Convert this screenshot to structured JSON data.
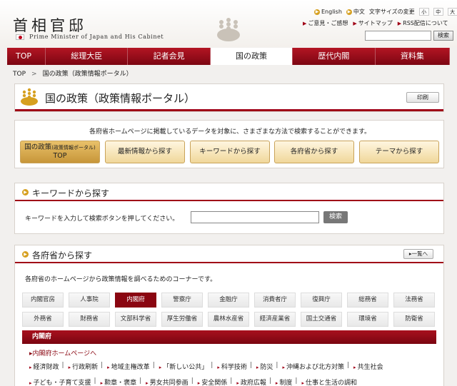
{
  "header": {
    "title": "首相官邸",
    "subtitle": "Prime Minister of Japan and His Cabinet",
    "lang_english": "English",
    "lang_chinese": "中文",
    "text_size_label": "文字サイズの変更",
    "size_small": "小",
    "size_medium": "中",
    "size_large": "大",
    "link_feedback": "ご意見・ご感想",
    "link_sitemap": "サイトマップ",
    "link_rss": "RSS配信について",
    "search_button": "検索",
    "accent_color": "#a00016"
  },
  "nav": {
    "items": [
      "TOP",
      "総理大臣",
      "記者会見",
      "国の政策",
      "歴代内閣",
      "資料集"
    ],
    "active": "国の政策"
  },
  "breadcrumb": {
    "top": "TOP",
    "separator": ">",
    "current": "国の政策（政策情報ポータル）"
  },
  "page": {
    "title": "国の政策（政策情報ポータル）",
    "print_button": "印刷"
  },
  "intro": {
    "text": "各府省ホームページに掲載しているデータを対象に、さまざまな方法で検索することができます。",
    "pill_top_line1": "国の政策",
    "pill_top_small": "(政策情報ポータル)",
    "pill_top_line2": "TOP",
    "pill_latest": "最新情報から探す",
    "pill_keyword": "キーワードから探す",
    "pill_ministry": "各府省から探す",
    "pill_theme": "テーマから探す"
  },
  "keyword": {
    "heading": "キーワードから探す",
    "label": "キーワードを入力して検索ボタンを押してください。",
    "value": "",
    "button": "検索"
  },
  "ministry": {
    "heading": "各府省から探す",
    "list_button": "一覧へ",
    "intro": "各府省のホームページから政策情報を調べるためのコーナーです。",
    "row1": [
      "内閣官房",
      "人事院",
      "内閣府",
      "警察庁",
      "金融庁",
      "消費者庁",
      "復興庁",
      "総務省",
      "法務省"
    ],
    "row2": [
      "外務省",
      "財務省",
      "文部科学省",
      "厚生労働省",
      "農林水産省",
      "経済産業省",
      "国土交通省",
      "環境省",
      "防衛省"
    ],
    "active": "内閣府",
    "selected_title": "内閣府",
    "selected_link": "内閣府ホームページへ",
    "cats_row1": [
      "経済財政",
      "行政刷新",
      "地域主権改革",
      "「新しい公共」",
      "科学技術",
      "防災",
      "沖縄および北方対策",
      "共生社会"
    ],
    "cats_row2": [
      "子ども・子育て支援",
      "勲章・褒章",
      "男女共同参画",
      "安全関係",
      "政府広報",
      "制度",
      "仕事と生活の調和"
    ]
  }
}
